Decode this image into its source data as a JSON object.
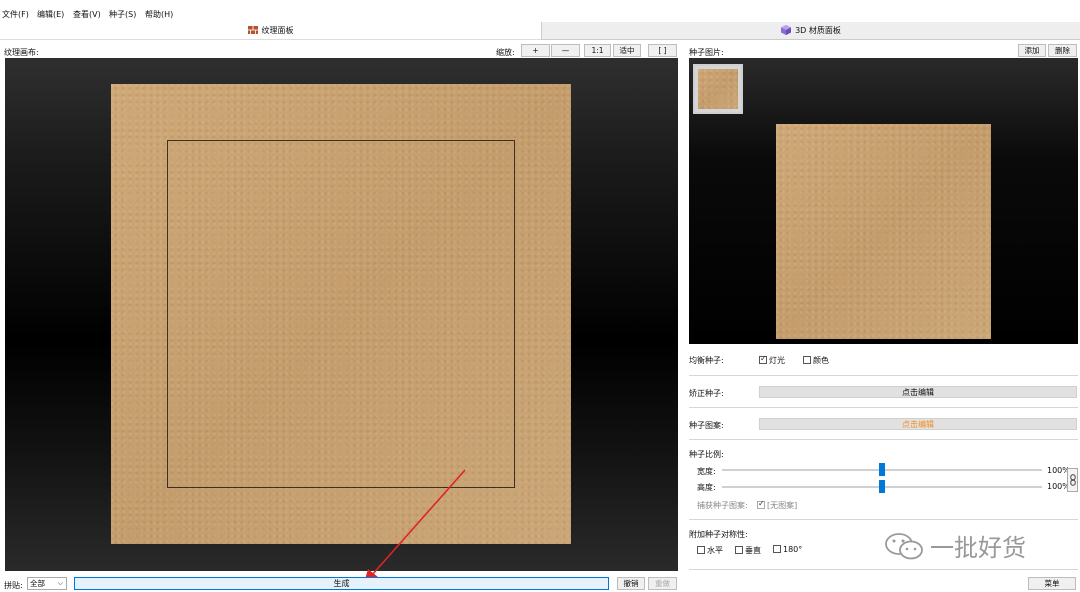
{
  "menu": {
    "items": [
      "文件(F)",
      "编辑(E)",
      "查看(V)",
      "种子(S)",
      "帮助(H)"
    ]
  },
  "tabs": {
    "texture_label": "纹理面板",
    "material_label": "3D 材质面板"
  },
  "canvas": {
    "label": "纹理画布:",
    "zoom_label": "缩放:",
    "zoom_in": "+",
    "zoom_out": "—",
    "actual_size": "1:1",
    "fit": "适中",
    "bracket": "[ ]"
  },
  "bottom": {
    "tile_label": "拼贴:",
    "tile_value": "全部",
    "generate": "生成",
    "undo": "撤销",
    "redo": "重做"
  },
  "seed_panel": {
    "label": "种子图片:",
    "add": "添加",
    "delete": "删除",
    "balance_label": "均衡种子:",
    "light_label": "灯光",
    "color_label": "颜色",
    "light_checked": true,
    "color_checked": false,
    "correct_label": "矫正种子:",
    "correct_btn": "点击编辑",
    "pattern_label": "种子图案:",
    "pattern_btn": "点击编辑",
    "scale_label": "种子比例:",
    "width_label": "宽度:",
    "width_value": "100%",
    "height_label": "高度:",
    "height_value": "100%",
    "width_fraction": 0.5,
    "height_fraction": 0.5,
    "capture_label": "捕获种子图案:",
    "capture_value": "[无图案]",
    "symmetry_label": "附加种子对称性:",
    "sym_h": "水平",
    "sym_v": "垂直",
    "sym_180": "180°",
    "menu_btn": "菜单"
  },
  "watermark": "一批好货",
  "colors": {
    "accent": "#0078d7",
    "pattern_text": "#f08c1e",
    "arrow": "#e02424",
    "texture": "#c8a272"
  }
}
